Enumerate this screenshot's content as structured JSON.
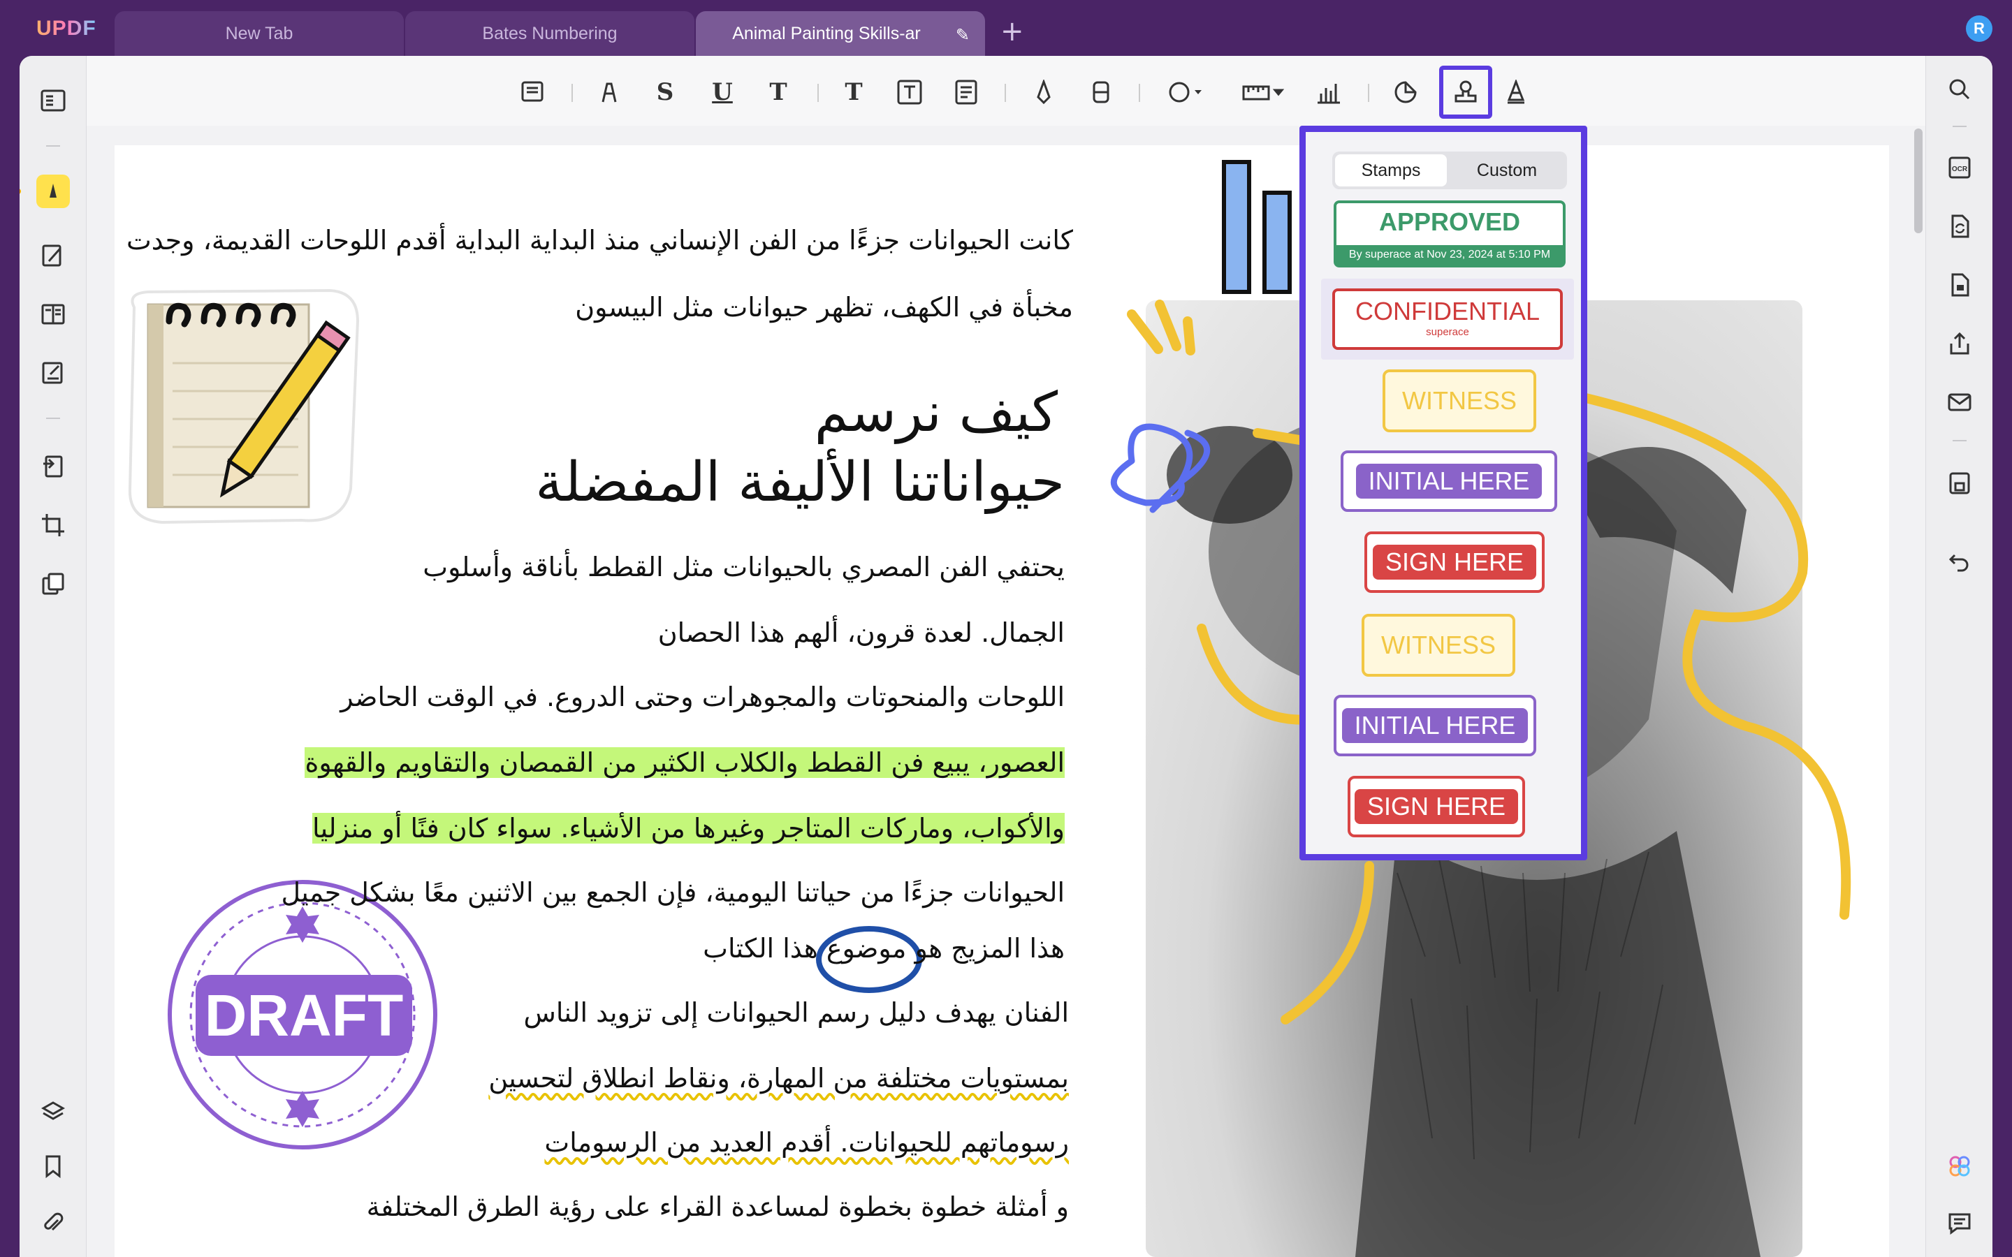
{
  "app": {
    "logo": "UPDF",
    "avatar_initial": "R"
  },
  "tabs": [
    {
      "label": "New Tab",
      "active": false
    },
    {
      "label": "Bates Numbering",
      "active": false
    },
    {
      "label": "Animal Painting Skills-ar",
      "active": true
    }
  ],
  "toolbar": {
    "tools": [
      "sticky-note",
      "highlighter",
      "strikethrough",
      "underline",
      "squiggly",
      "text",
      "text-box",
      "text-callout",
      "pencil",
      "eraser",
      "shape",
      "measure",
      "chart",
      "sticker",
      "stamp",
      "signature"
    ],
    "selected_tool": "stamp"
  },
  "stamp_popup": {
    "tabs": {
      "stamps": "Stamps",
      "custom": "Custom"
    },
    "approved": {
      "label": "APPROVED",
      "sub": "By superace at Nov 23, 2024 at 5:10 PM"
    },
    "confidential": {
      "label": "CONFIDENTIAL",
      "sub": "superace"
    },
    "witness": "WITNESS",
    "initial_here": "INITIAL HERE",
    "sign_here": "SIGN HERE"
  },
  "document": {
    "intro": [
      "كانت الحيوانات جزءًا من الفن الإنساني منذ البداية البداية أقدم اللوحات القديمة، وجدت",
      "مخبأة في الكهف، تظهر حيوانات مثل البيسون"
    ],
    "heading": [
      "كيف نرسم",
      "حيواناتنا الأليفة المفضلة"
    ],
    "lines": [
      "يحتفي الفن المصري بالحيوانات مثل القطط بأناقة وأسلوب",
      "الجمال. لعدة قرون، ألهم هذا الحصان",
      "اللوحات والمنحوتات والمجوهرات وحتى الدروع. في الوقت الحاضر",
      "العصور، يبيع فن القطط والكلاب الكثير من القمصان والتقاويم والقهوة",
      "والأكواب، وماركات المتاجر وغيرها من الأشياء. سواء كان فنًا أو منزليا",
      "الحيوانات جزءًا من حياتنا اليومية، فإن الجمع بين الاثنين معًا بشكل جميل",
      "هذا المزيج هو موضوع هذا الكتاب",
      "الفنان يهدف دليل رسم الحيوانات إلى تزويد الناس",
      "بمستويات مختلفة من المهارة، ونقاط انطلاق لتحسين",
      "رسوماتهم للحيوانات. أقدم العديد من الرسومات",
      "و أمثلة خطوة بخطوة لمساعدة القراء على رؤية الطرق المختلفة"
    ],
    "draft_stamp": "DRAFT"
  },
  "colors": {
    "accent": "#5b3ce0",
    "highlight": "#c4f77a",
    "draft": "#8e5fd1"
  }
}
